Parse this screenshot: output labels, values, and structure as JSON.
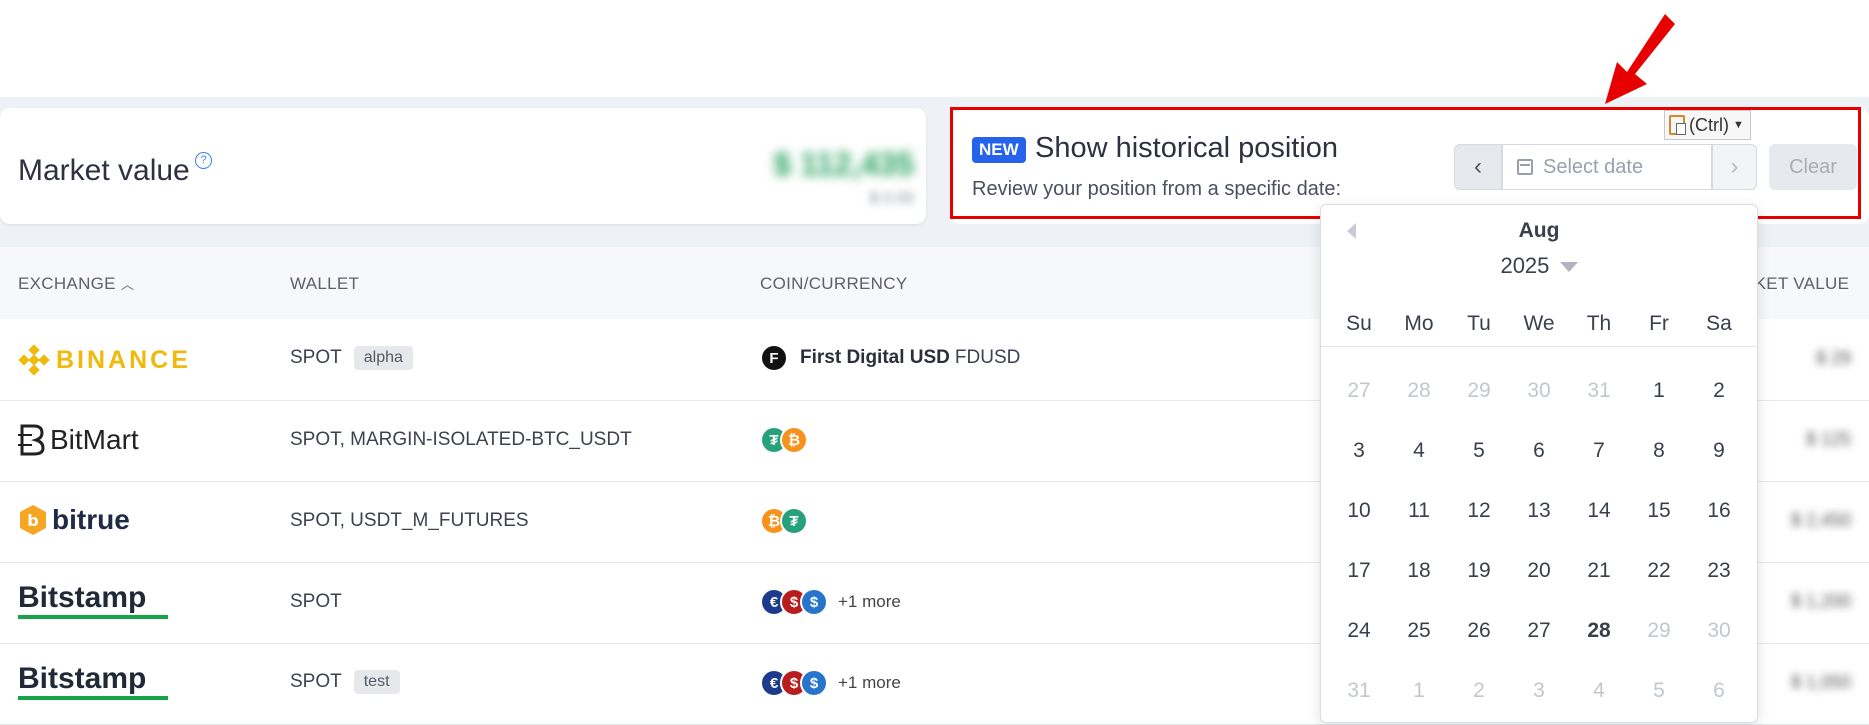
{
  "market_value": {
    "title": "Market value",
    "help_icon": "help-circle-icon",
    "amount": "$ 112,435",
    "sub": "$ 0.00"
  },
  "historical": {
    "badge": "NEW",
    "title": "Show historical position",
    "description": "Review your position from a specific date:",
    "date_placeholder": "Select date",
    "clear_label": "Clear",
    "prev_icon": "chevron-left-icon",
    "next_icon": "chevron-right-icon"
  },
  "paste_tip": {
    "label": "(Ctrl)",
    "icon": "clipboard-icon"
  },
  "table": {
    "headers": {
      "exchange": "EXCHANGE",
      "wallet": "WALLET",
      "coin": "COIN/CURRENCY",
      "market_value": "RKET VALUE"
    },
    "rows": [
      {
        "exchange": "BINANCE",
        "wallet": "SPOT",
        "tag": "alpha",
        "coin_name": "First Digital USD",
        "coin_ticker": "FDUSD",
        "more": "",
        "value": "$ 29"
      },
      {
        "exchange": "BitMart",
        "wallet": "SPOT, MARGIN-ISOLATED-BTC_USDT",
        "tag": "",
        "coin_name": "",
        "coin_ticker": "",
        "more": "",
        "value": "$ 125"
      },
      {
        "exchange": "bitrue",
        "wallet": "SPOT, USDT_M_FUTURES",
        "tag": "",
        "coin_name": "",
        "coin_ticker": "",
        "more": "",
        "value": "$ 2,450"
      },
      {
        "exchange": "Bitstamp",
        "wallet": "SPOT",
        "tag": "",
        "coin_name": "",
        "coin_ticker": "",
        "more": "+1 more",
        "value": "$ 1,200"
      },
      {
        "exchange": "Bitstamp",
        "wallet": "SPOT",
        "tag": "test",
        "coin_name": "",
        "coin_ticker": "",
        "more": "+1 more",
        "value": "$ 1,050"
      }
    ]
  },
  "datepicker": {
    "month": "Aug",
    "year": "2025",
    "dows": [
      "Su",
      "Mo",
      "Tu",
      "We",
      "Th",
      "Fr",
      "Sa"
    ],
    "days": [
      "27",
      "28",
      "29",
      "30",
      "31",
      "1",
      "2",
      "3",
      "4",
      "5",
      "6",
      "7",
      "8",
      "9",
      "10",
      "11",
      "12",
      "13",
      "14",
      "15",
      "16",
      "17",
      "18",
      "19",
      "20",
      "21",
      "22",
      "23",
      "24",
      "25",
      "26",
      "27",
      "28",
      "29",
      "30",
      "31",
      "1",
      "2",
      "3",
      "4",
      "5",
      "6"
    ]
  },
  "colors": {
    "accent": "#2563eb",
    "highlight_border": "#e60000",
    "binance": "#f0b90b",
    "bitstamp_green": "#16a34a"
  }
}
